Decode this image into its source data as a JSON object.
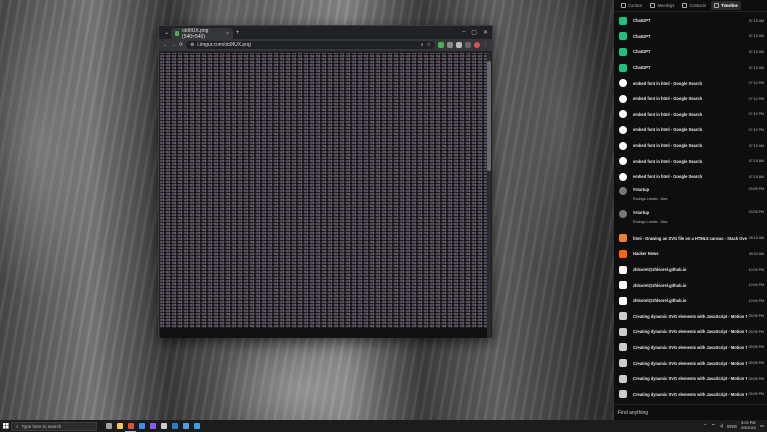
{
  "browser": {
    "tab_title": "ob9IUX.png (540×540)",
    "url": "i.imgur.com/ob9IUX.png",
    "new_tab_symbol": "+",
    "nav": {
      "back": "←",
      "forward": "→",
      "reload": "⟳"
    }
  },
  "panel": {
    "tabs": [
      {
        "label": "Context",
        "icon": "context-icon"
      },
      {
        "label": "Meetings",
        "icon": "calendar-icon"
      },
      {
        "label": "Contacts",
        "icon": "contacts-icon"
      },
      {
        "label": "Timeline",
        "icon": "timeline-icon",
        "active": true
      }
    ],
    "items": [
      {
        "title": "ChatGPT",
        "time": "07:15 AM",
        "icon": "chatgpt-icon",
        "color": "#19c37d"
      },
      {
        "title": "ChatGPT",
        "time": "07:15 AM",
        "icon": "chatgpt-icon",
        "color": "#19c37d"
      },
      {
        "title": "ChatGPT",
        "time": "07:15 AM",
        "icon": "chatgpt-icon",
        "color": "#19c37d"
      },
      {
        "title": "ChatGPT",
        "time": "07:15 AM",
        "icon": "chatgpt-icon",
        "color": "#19c37d"
      },
      {
        "title": "embed font in html - Google Search",
        "time": "07:14 PM",
        "icon": "google-icon",
        "color": "#ffffff"
      },
      {
        "title": "embed font in html - Google Search",
        "time": "07:14 PM",
        "icon": "google-icon",
        "color": "#ffffff"
      },
      {
        "title": "embed font in html - Google Search",
        "time": "07:14 PM",
        "icon": "google-icon",
        "color": "#ffffff"
      },
      {
        "title": "embed font in html - Google Search",
        "time": "07:14 PM",
        "icon": "google-icon",
        "color": "#ffffff"
      },
      {
        "title": "embed font in html - Google Search",
        "time": "07:15 AM",
        "icon": "google-icon",
        "color": "#ffffff"
      },
      {
        "title": "embed font in html - Google Search",
        "time": "07:15 AM",
        "icon": "google-icon",
        "color": "#ffffff"
      },
      {
        "title": "embed font in html - Google Search",
        "time": "07:15 AM",
        "icon": "google-icon",
        "color": "#ffffff"
      }
    ],
    "meetings": [
      {
        "title": "#startup",
        "time": "03:05 PM",
        "people": [
          "Rodrigo Lobato",
          "Alex"
        ]
      },
      {
        "title": "#startup",
        "time": "03:05 PM",
        "people": [
          "Rodrigo Lobato",
          "Alex"
        ]
      }
    ],
    "items2": [
      {
        "title": "html - Drawing an SVG file on a HTML5 canvas - Stack Overflow",
        "time": "05:15 AM",
        "icon": "stackoverflow-icon",
        "color": "#f48024"
      },
      {
        "title": "Hacker News",
        "time": "09:03 AM",
        "icon": "hackernews-icon",
        "color": "#ff6600"
      },
      {
        "title": "zhlsorel@zhlsorel.github.io",
        "time": "10:04 PM",
        "icon": "github-icon",
        "color": "#ffffff"
      },
      {
        "title": "zhlsorel@zhlsorel.github.io",
        "time": "10:04 PM",
        "icon": "github-icon",
        "color": "#ffffff"
      },
      {
        "title": "zhlsorel@zhlsorel.github.io",
        "time": "10:04 PM",
        "icon": "github-icon",
        "color": "#ffffff"
      },
      {
        "title": "Creating dynamic SVG elements with JavaScript - Motion Tricks",
        "time": "09:06 PM",
        "icon": "motiontricks-icon",
        "color": "#cccccc"
      },
      {
        "title": "Creating dynamic SVG elements with JavaScript - Motion Tricks",
        "time": "09:06 PM",
        "icon": "motiontricks-icon",
        "color": "#cccccc"
      },
      {
        "title": "Creating dynamic SVG elements with JavaScript - Motion Tricks",
        "time": "09:05 PM",
        "icon": "motiontricks-icon",
        "color": "#cccccc"
      },
      {
        "title": "Creating dynamic SVG elements with JavaScript - Motion Tricks",
        "time": "09:05 PM",
        "icon": "motiontricks-icon",
        "color": "#cccccc"
      },
      {
        "title": "Creating dynamic SVG elements with JavaScript - Motion Tricks",
        "time": "09:05 PM",
        "icon": "motiontricks-icon",
        "color": "#cccccc"
      },
      {
        "title": "Creating dynamic SVG elements with JavaScript - Motion Tricks",
        "time": "09:05 PM",
        "icon": "motiontricks-icon",
        "color": "#cccccc"
      }
    ],
    "find_placeholder": "Find anything"
  },
  "taskbar": {
    "search_placeholder": "Type here to search",
    "apps": [
      {
        "name": "taskview-icon",
        "color": "#9aa0a6"
      },
      {
        "name": "explorer-icon",
        "color": "#f2c94c"
      },
      {
        "name": "chrome-icon",
        "color": "#e44d3a",
        "active": true
      },
      {
        "name": "vscode-icon",
        "color": "#3b8eea"
      },
      {
        "name": "visualstudio-icon",
        "color": "#8a5cf6"
      },
      {
        "name": "terminal-icon",
        "color": "#cccccc"
      },
      {
        "name": "word-icon",
        "color": "#2b7cd3"
      },
      {
        "name": "app-icon",
        "color": "#4aa3df"
      },
      {
        "name": "photos-icon",
        "color": "#3aa0e8"
      }
    ],
    "lang": "ENG",
    "time": "5:03 PM",
    "date": "2/9/2024"
  }
}
